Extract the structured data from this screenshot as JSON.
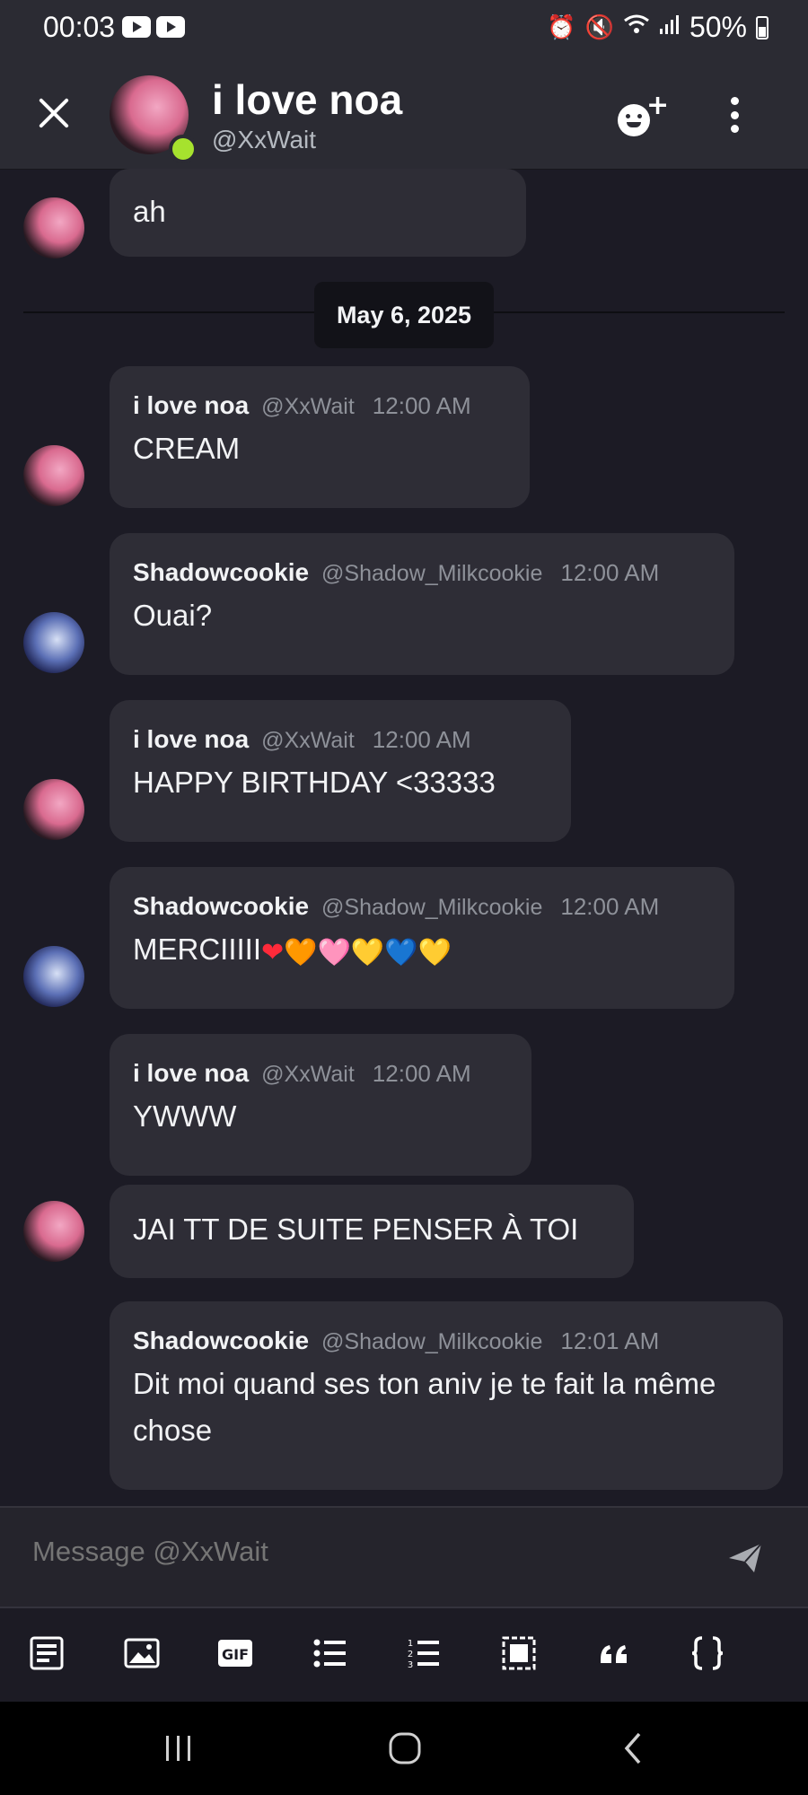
{
  "status_bar": {
    "time": "00:03",
    "battery": "50%"
  },
  "header": {
    "title": "i love noa",
    "handle": "@XxWait"
  },
  "date_divider": "May 6, 2025",
  "partial_message": {
    "text": "ah"
  },
  "messages": [
    {
      "name": "i love noa",
      "handle": "@XxWait",
      "time": "12:00 AM",
      "text": "CREAM"
    },
    {
      "name": "Shadowcookie",
      "handle": "@Shadow_Milkcookie",
      "time": "12:00 AM",
      "text": "Ouai?"
    },
    {
      "name": "i love noa",
      "handle": "@XxWait",
      "time": "12:00 AM",
      "text": "HAPPY BIRTHDAY <33333"
    },
    {
      "name": "Shadowcookie",
      "handle": "@Shadow_Milkcookie",
      "time": "12:00 AM",
      "text": "MERCIIIII"
    },
    {
      "name": "i love noa",
      "handle": "@XxWait",
      "time": "12:00 AM",
      "text": "YWWW"
    },
    {
      "text": "JAI TT DE SUITE PENSER À TOI"
    },
    {
      "name": "Shadowcookie",
      "handle": "@Shadow_Milkcookie",
      "time": "12:01 AM",
      "text": "Dit moi quand ses ton aniv je te fait la même chose"
    }
  ],
  "hearts": [
    "❤",
    "🧡",
    "🩷",
    "💛",
    "💙",
    "💛"
  ],
  "heart_colors": [
    "#ff2a3a",
    "#ff8a1c",
    "#ff9ad0",
    "#ffd21c",
    "#1fa5ff",
    "#ffd21c"
  ],
  "composer": {
    "placeholder": "Message @XxWait"
  },
  "toolbar_icons": [
    "text-format-icon",
    "image-icon",
    "gif-icon",
    "bulleted-list-icon",
    "numbered-list-icon",
    "spoiler-icon",
    "quote-icon",
    "code-block-icon"
  ],
  "theme": {
    "background": "#1c1b25",
    "bubble": "#2e2d36",
    "header": "#2b2b33",
    "online": "#a6e22e"
  }
}
